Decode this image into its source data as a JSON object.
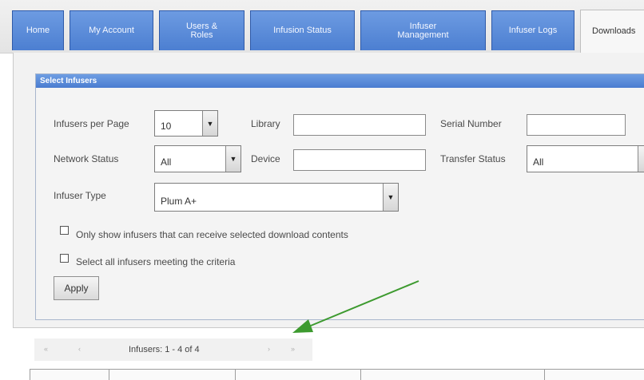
{
  "tabs": [
    {
      "label": "Home"
    },
    {
      "label": "My Account"
    },
    {
      "label": "Users &\nRoles"
    },
    {
      "label": "Infusion Status"
    },
    {
      "label": "Infuser\nManagement"
    },
    {
      "label": "Infuser Logs"
    },
    {
      "label": "Downloads"
    }
  ],
  "section": {
    "title": "Select Infusers"
  },
  "filters": {
    "per_page_label": "Infusers per Page",
    "per_page_value": "10",
    "library_label": "Library",
    "library_value": "",
    "serial_label": "Serial Number",
    "serial_value": "",
    "network_label": "Network Status",
    "network_value": "All",
    "device_label": "Device",
    "device_value": "",
    "transfer_label": "Transfer Status",
    "transfer_value": "All",
    "type_label": "Infuser Type",
    "type_value": "Plum A+"
  },
  "options": {
    "only_show_label": "Only show infusers that can receive selected download contents",
    "select_all_label": "Select all infusers meeting the criteria"
  },
  "apply_label": "Apply",
  "pager": {
    "first": "«",
    "prev": "‹",
    "info": "Infusers: 1 - 4 of 4",
    "next": "›",
    "last": "»"
  },
  "annotation": {
    "arrow_color": "#3d9a2f"
  }
}
